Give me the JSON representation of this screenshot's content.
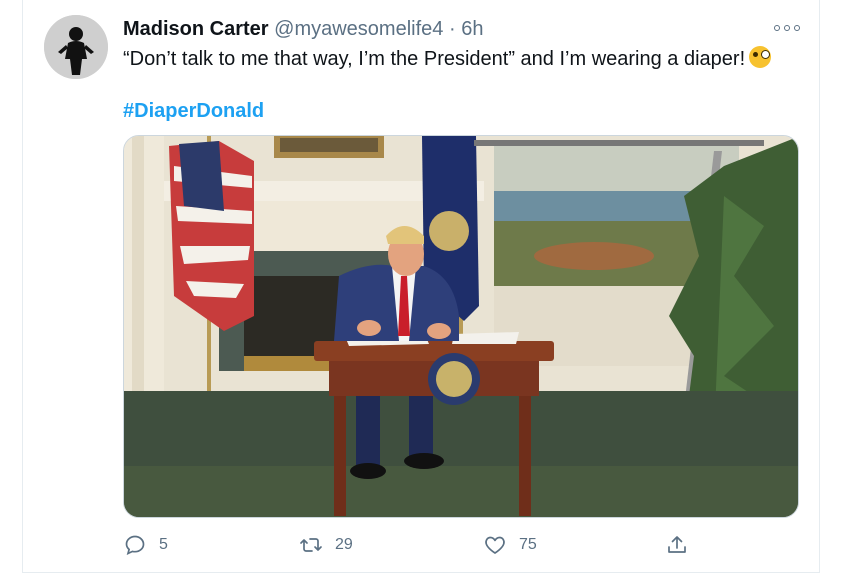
{
  "user": {
    "name": "Madison Carter",
    "handle": "@myawesomelife4",
    "separator": "·",
    "time": "6h"
  },
  "tweet": {
    "text": "“Don’t talk to me that way, I’m the President” and I’m wearing a diaper!",
    "hashtag": "#DiaperDonald",
    "emoji": "zany-face-emoji"
  },
  "media": {
    "icon": "photo-image"
  },
  "actions": {
    "reply_count": "5",
    "retweet_count": "29",
    "like_count": "75",
    "share_icon": "share-icon"
  },
  "colors": {
    "hashtag": "#1da1f2",
    "secondary_text": "#5b7083",
    "border": "#e6ecf0"
  }
}
